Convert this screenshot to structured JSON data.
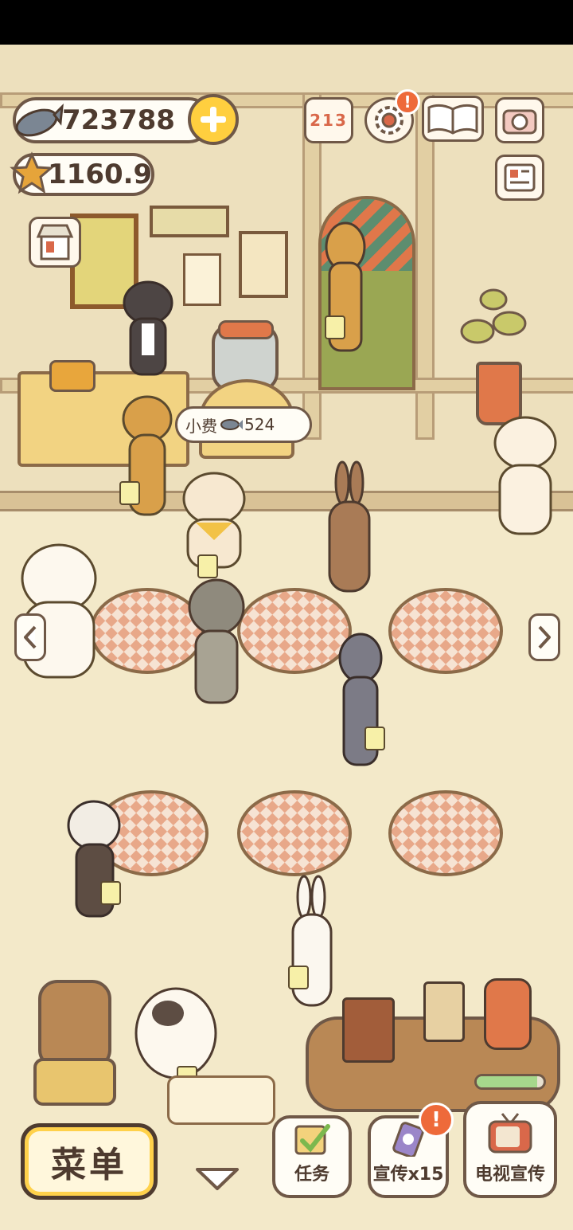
{
  "currency": {
    "fish_amount": "723788",
    "star_amount": "1160.9"
  },
  "tip_bubble": {
    "label": "小费",
    "amount": "524"
  },
  "bottom_bar": {
    "menu_label": "菜单",
    "tasks_label": "任务",
    "promo_label": "宣传x15",
    "tv_promo_label": "电视宣传",
    "alert_mark": "!"
  },
  "top_icons": {
    "ranking_digits": "213",
    "settings_alert": "!"
  },
  "colors": {
    "accent_yellow": "#ffcf3f",
    "outline_brown": "#6f5847",
    "alert_orange": "#ee6a3a",
    "tablecloth": "#e8a889"
  }
}
